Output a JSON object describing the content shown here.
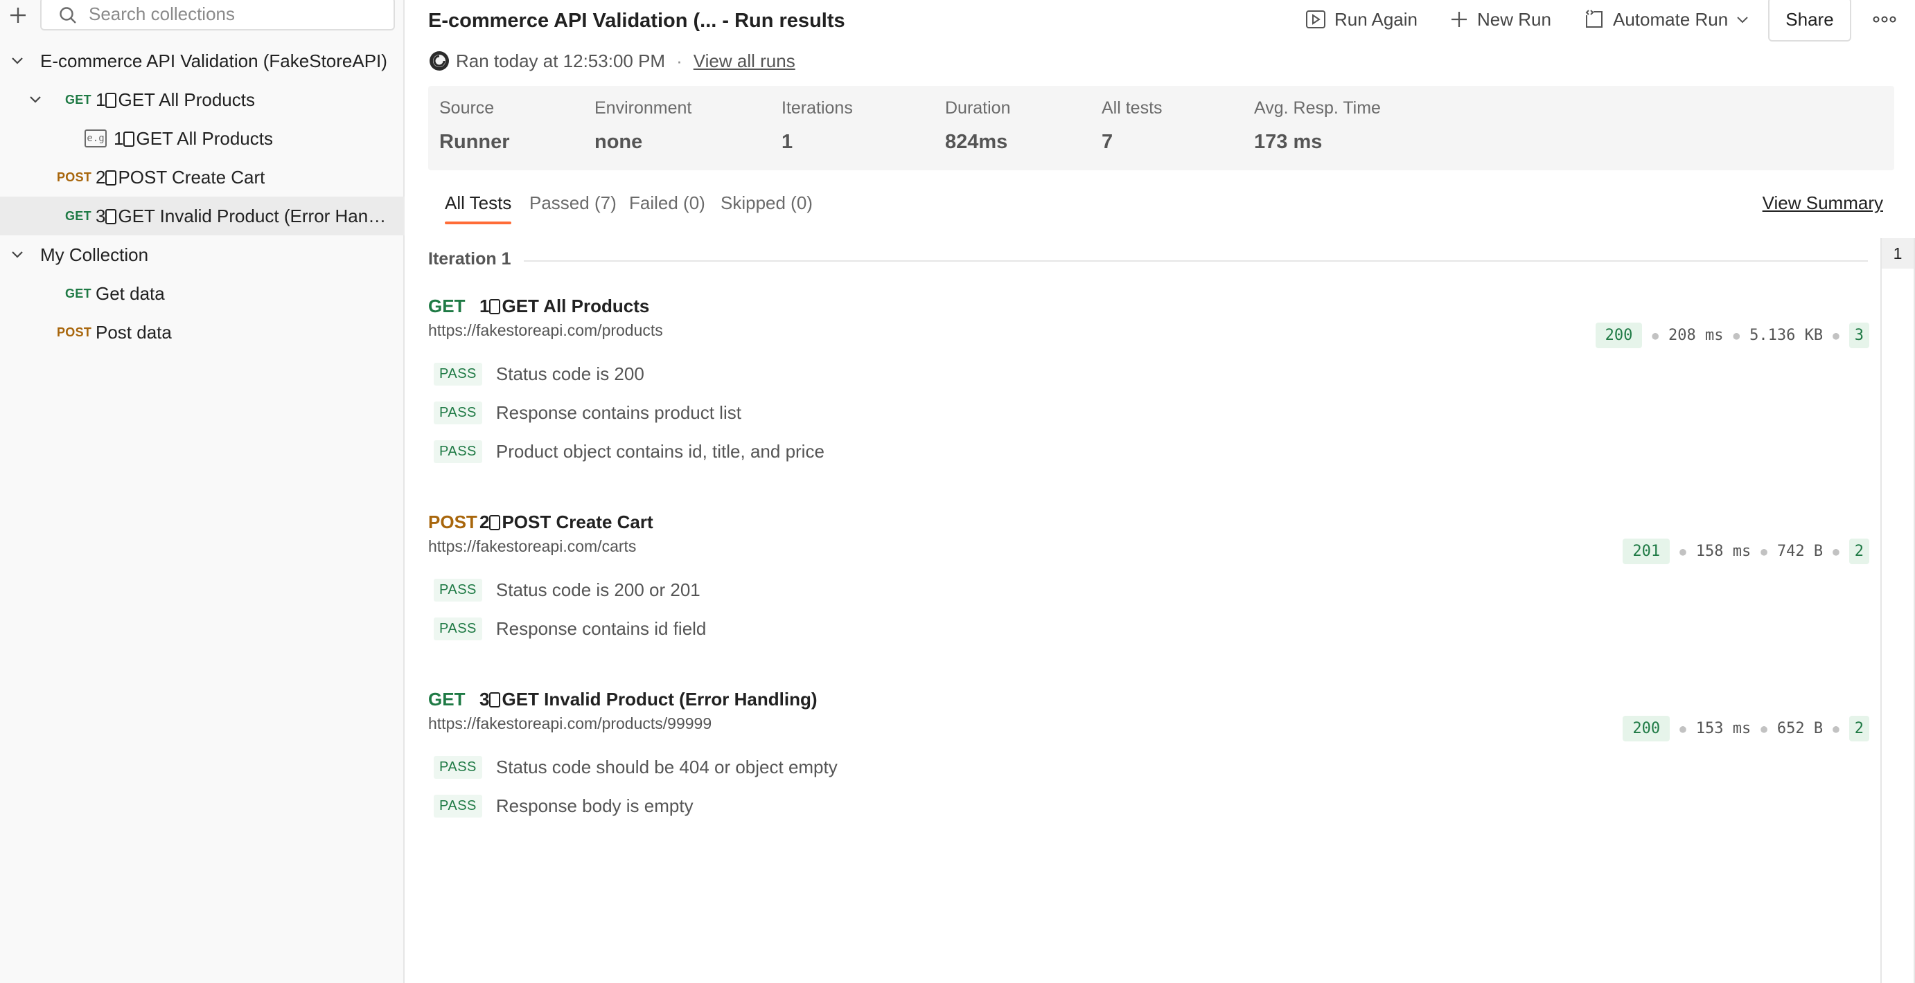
{
  "sidebar": {
    "search_placeholder": "Search collections",
    "collections": [
      {
        "name": "E-commerce API Validation (FakeStoreAPI)",
        "requests": [
          {
            "method": "GET",
            "num": "1",
            "label": "GET All Products",
            "example": {
              "num": "1",
              "label": "GET All Products"
            }
          },
          {
            "method": "POST",
            "num": "2",
            "label": "POST Create Cart"
          },
          {
            "method": "GET",
            "num": "3",
            "label": "GET Invalid Product (Error Handl..."
          }
        ]
      },
      {
        "name": "My Collection",
        "requests": [
          {
            "method": "GET",
            "label": "Get data"
          },
          {
            "method": "POST",
            "label": "Post data"
          }
        ]
      }
    ]
  },
  "header": {
    "title": "E-commerce API Validation (... - Run results",
    "ran_text": "Ran today at 12:53:00 PM",
    "separator": "·",
    "view_all_runs": "View all runs",
    "run_again": "Run Again",
    "new_run": "New Run",
    "automate_run": "Automate Run",
    "share": "Share"
  },
  "stats": [
    {
      "label": "Source",
      "value": "Runner"
    },
    {
      "label": "Environment",
      "value": "none"
    },
    {
      "label": "Iterations",
      "value": "1"
    },
    {
      "label": "Duration",
      "value": "824ms"
    },
    {
      "label": "All tests",
      "value": "7"
    },
    {
      "label": "Avg. Resp. Time",
      "value": "173 ms"
    }
  ],
  "tabs": {
    "all": "All Tests",
    "passed": "Passed (7)",
    "failed": "Failed (0)",
    "skipped": "Skipped (0)",
    "view_summary": "View Summary"
  },
  "iteration": {
    "label": "Iteration 1",
    "number": "1"
  },
  "requests": [
    {
      "method": "GET",
      "num": "1",
      "name": "GET All Products",
      "url": "https://fakestoreapi.com/products",
      "status": "200",
      "time": "208 ms",
      "size": "5.136 KB",
      "count": "3",
      "tests": [
        {
          "result": "PASS",
          "name": "Status code is 200"
        },
        {
          "result": "PASS",
          "name": "Response contains product list"
        },
        {
          "result": "PASS",
          "name": "Product object contains id, title, and price"
        }
      ]
    },
    {
      "method": "POST",
      "num": "2",
      "name": "POST Create Cart",
      "url": "https://fakestoreapi.com/carts",
      "status": "201",
      "time": "158 ms",
      "size": "742 B",
      "count": "2",
      "tests": [
        {
          "result": "PASS",
          "name": "Status code is 200 or 201"
        },
        {
          "result": "PASS",
          "name": "Response contains id field"
        }
      ]
    },
    {
      "method": "GET",
      "num": "3",
      "name": "GET Invalid Product (Error Handling)",
      "url": "https://fakestoreapi.com/products/99999",
      "status": "200",
      "time": "153 ms",
      "size": "652 B",
      "count": "2",
      "tests": [
        {
          "result": "PASS",
          "name": "Status code should be 404 or object empty"
        },
        {
          "result": "PASS",
          "name": "Response body is empty"
        }
      ]
    }
  ],
  "colors": {
    "get": "#1f7a45",
    "post": "#a8660c",
    "pass": "#1f7a45",
    "accent": "#ff6c37"
  },
  "icons": [
    "plus-icon",
    "search-icon",
    "chevron-down-icon",
    "example-icon",
    "runner-icon",
    "play-icon",
    "plus-icon",
    "automate-icon",
    "more-icon"
  ]
}
